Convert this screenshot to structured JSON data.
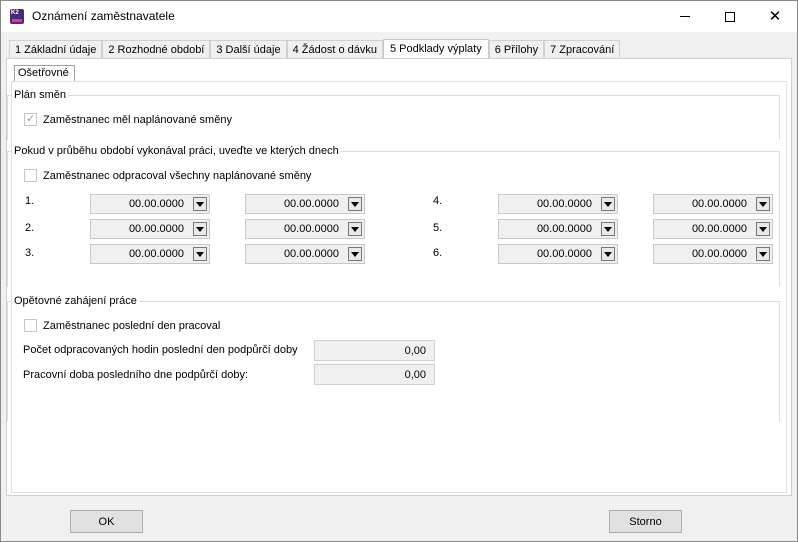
{
  "window": {
    "title": "Oznámení zaměstnavatele",
    "icon_text": "K2",
    "controls": [
      "minimize-icon",
      "maximize-icon",
      "close-icon"
    ]
  },
  "tabs": [
    {
      "label": "1 Základní údaje"
    },
    {
      "label": "2 Rozhodné období"
    },
    {
      "label": "3 Další údaje"
    },
    {
      "label": "4 Žádost o dávku"
    },
    {
      "label": "5 Podklady výplaty",
      "active": true
    },
    {
      "label": "6 Přílohy"
    },
    {
      "label": "7 Zpracování"
    }
  ],
  "subtab": {
    "label": "Ošetřovné"
  },
  "plan": {
    "title": "Plán směn",
    "checkbox_label": "Zaměstnanec měl naplánované směny",
    "checked": true
  },
  "work": {
    "title": "Pokud v průběhu období vykonával práci, uveďte ve kterých dnech",
    "checkbox_label": "Zaměstnanec odpracoval všechny naplánované směny",
    "checked": false,
    "rows": [
      {
        "num": "1.",
        "from": "00.00.0000",
        "to": "00.00.0000"
      },
      {
        "num": "2.",
        "from": "00.00.0000",
        "to": "00.00.0000"
      },
      {
        "num": "3.",
        "from": "00.00.0000",
        "to": "00.00.0000"
      },
      {
        "num": "4.",
        "from": "00.00.0000",
        "to": "00.00.0000"
      },
      {
        "num": "5.",
        "from": "00.00.0000",
        "to": "00.00.0000"
      },
      {
        "num": "6.",
        "from": "00.00.0000",
        "to": "00.00.0000"
      }
    ]
  },
  "resume": {
    "title": "Opětovné zahájení práce",
    "checkbox_label": "Zaměstnanec poslední den pracoval",
    "checked": false,
    "hours_label": "Počet odpracovaných hodin poslední den podpůrčí doby",
    "hours_value": "0,00",
    "time_label": "Pracovní doba posledního dne podpůrčí doby:",
    "time_value": "0,00"
  },
  "buttons": {
    "ok": "OK",
    "cancel": "Storno"
  }
}
